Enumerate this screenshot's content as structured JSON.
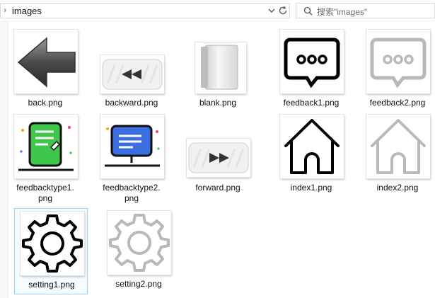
{
  "address_bar": {
    "path": "images"
  },
  "search": {
    "placeholder": "搜索\"images\""
  },
  "files": [
    {
      "name": "back.png"
    },
    {
      "name": "backward.png"
    },
    {
      "name": "blank.png"
    },
    {
      "name": "feedback1.png"
    },
    {
      "name": "feedback2.png"
    },
    {
      "name_line1": "feedbacktype1.",
      "name_line2": "png"
    },
    {
      "name_line1": "feedbacktype2.",
      "name_line2": "png"
    },
    {
      "name": "forward.png"
    },
    {
      "name": "index1.png"
    },
    {
      "name": "index2.png"
    },
    {
      "name": "setting1.png",
      "selected": true
    },
    {
      "name": "setting2.png"
    }
  ],
  "colors": {
    "selection_border": "#99d1ff",
    "doc_green": "#3ec64a",
    "monitor_blue": "#3d6ee0"
  },
  "icons": [
    "chevron-right-icon",
    "chevron-down-icon",
    "refresh-icon",
    "search-icon"
  ]
}
